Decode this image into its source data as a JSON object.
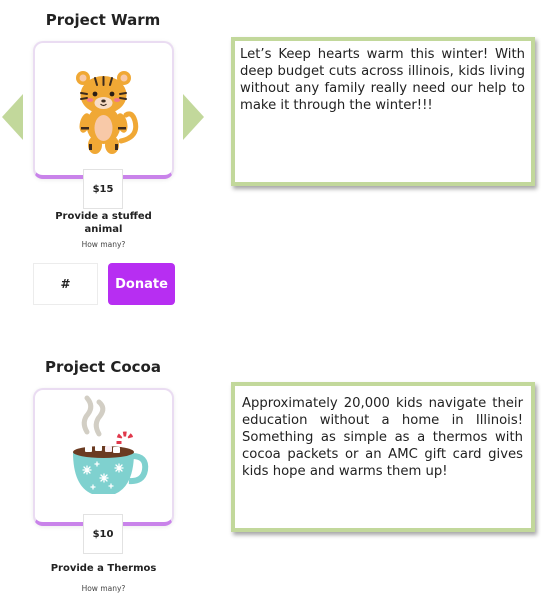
{
  "projects": [
    {
      "title": "Project Warm",
      "image_icon": "tiger-plush-icon",
      "price": "$15",
      "item_name": "Provide a stuffed animal",
      "how_many_label": "How many?",
      "quantity_placeholder": "#",
      "donate_label": "Donate",
      "description": "Let’s Keep hearts warm this winter!  With deep budget cuts across illinois, kids living without any family really need our help to make it through the winter!!!"
    },
    {
      "title": "Project Cocoa",
      "image_icon": "hot-cocoa-mug-icon",
      "price": "$10",
      "item_name": "Provide a Thermos",
      "how_many_label": "How many?",
      "description": "Approximately 20,000 kids navigate their education without a home in Illinois!  Something as simple as a thermos with cocoa packets or an AMC gift card gives kids hope and warms them up!"
    }
  ],
  "carousel": {
    "prev_icon": "arrow-left-icon",
    "next_icon": "arrow-right-icon"
  },
  "colors": {
    "accent_purple": "#b72ef2",
    "card_border": "#c983ea",
    "description_border": "#c2d89b",
    "arrow_green": "#c2d89b"
  }
}
